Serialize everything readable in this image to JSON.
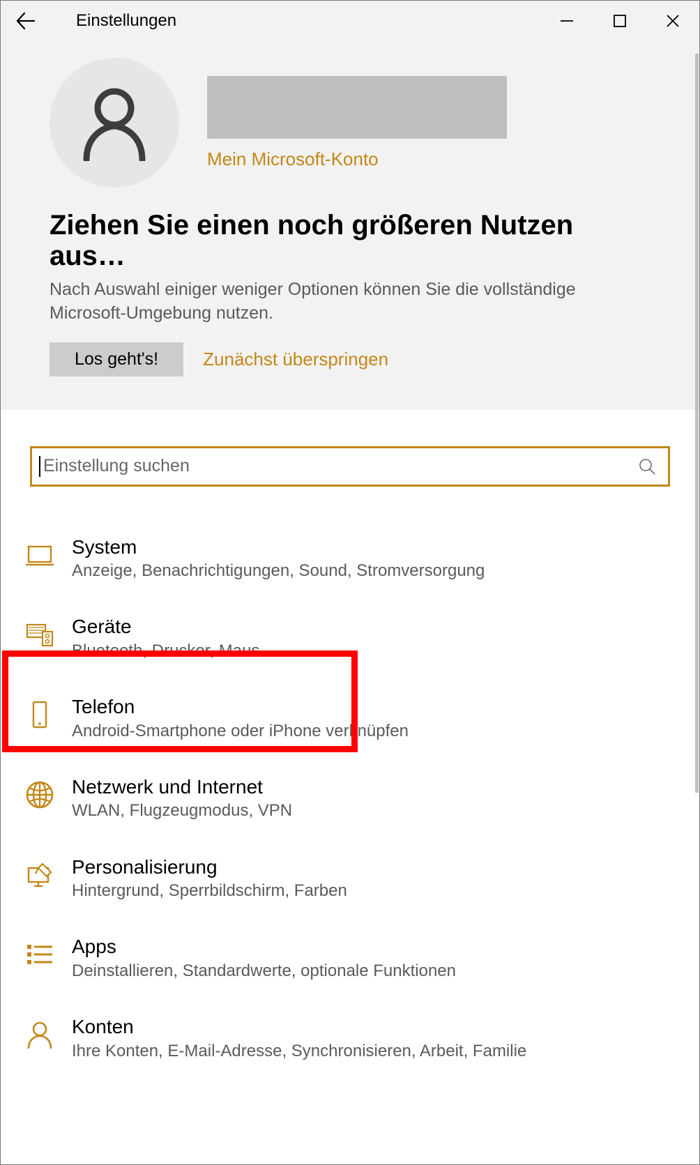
{
  "window": {
    "title": "Einstellungen"
  },
  "colors": {
    "accent": "#c38719",
    "highlight": "#ff0000"
  },
  "account": {
    "link_label": "Mein Microsoft-Konto"
  },
  "banner": {
    "headline": "Ziehen Sie einen noch größeren Nutzen aus…",
    "subtext": "Nach Auswahl einiger weniger Optionen können Sie die vollständige Microsoft-Umgebung nutzen.",
    "go_label": "Los geht's!",
    "skip_label": "Zunächst überspringen"
  },
  "search": {
    "placeholder": "Einstellung suchen",
    "value": ""
  },
  "categories": [
    {
      "icon": "laptop-icon",
      "title": "System",
      "desc": "Anzeige, Benachrichtigungen, Sound, Stromversorgung"
    },
    {
      "icon": "devices-icon",
      "title": "Geräte",
      "desc": "Bluetooth, Drucker, Maus"
    },
    {
      "icon": "phone-icon",
      "title": "Telefon",
      "desc": "Android-Smartphone oder iPhone verknüpfen"
    },
    {
      "icon": "globe-icon",
      "title": "Netzwerk und Internet",
      "desc": "WLAN, Flugzeugmodus, VPN",
      "highlighted": true
    },
    {
      "icon": "personalize-icon",
      "title": "Personalisierung",
      "desc": "Hintergrund, Sperrbildschirm, Farben"
    },
    {
      "icon": "apps-icon",
      "title": "Apps",
      "desc": "Deinstallieren, Standardwerte, optionale Funktionen"
    },
    {
      "icon": "accounts-icon",
      "title": "Konten",
      "desc": "Ihre Konten, E-Mail-Adresse, Synchronisieren, Arbeit, Familie"
    }
  ]
}
